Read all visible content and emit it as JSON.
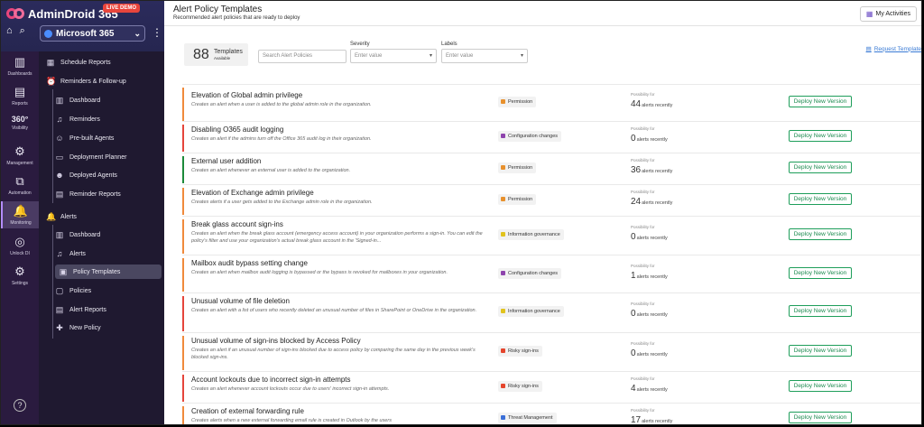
{
  "brand": {
    "name": "AdminDroid 365",
    "badge": "LIVE DEMO"
  },
  "tenant": {
    "name": "Microsoft 365"
  },
  "rail": [
    {
      "label": "Dashboards",
      "icon": "dashboards-icon"
    },
    {
      "label": "Reports",
      "icon": "reports-icon"
    },
    {
      "label": "Visibility",
      "icon": "visibility-360-icon"
    },
    {
      "label": "Management",
      "icon": "management-icon"
    },
    {
      "label": "Automation",
      "icon": "automation-icon"
    },
    {
      "label": "Monitoring",
      "icon": "monitoring-icon"
    },
    {
      "label": "Unlock DI",
      "icon": "unlock-di-icon"
    },
    {
      "label": "Settings",
      "icon": "settings-icon"
    }
  ],
  "nav": {
    "schedule_reports": "Schedule Reports",
    "reminders_followup": "Reminders & Follow-up",
    "rem_dashboard": "Dashboard",
    "reminders": "Reminders",
    "prebuilt_agents": "Pre-built Agents",
    "deployment_planner": "Deployment Planner",
    "deployed_agents": "Deployed Agents",
    "reminder_reports": "Reminder Reports",
    "alerts": "Alerts",
    "alerts_dashboard": "Dashboard",
    "alerts_alerts": "Alerts",
    "policy_templates": "Policy Templates",
    "policies": "Policies",
    "alert_reports": "Alert Reports",
    "new_policy": "New Policy"
  },
  "header": {
    "title": "Alert Policy Templates",
    "subtitle": "Recommended alert policies that are ready to deploy",
    "my_activities": "My Activities"
  },
  "toolbar": {
    "count": "88",
    "count_label": "Templates",
    "count_sub": "Available",
    "search_placeholder": "Search Alert Policies",
    "severity_label": "Severity",
    "severity_value": "Enter value",
    "labels_label": "Labels",
    "labels_value": "Enter value",
    "request": "Request Template"
  },
  "colors": {
    "orange": "#f08a3c",
    "red": "#e5453b",
    "green": "#1c8a3a",
    "permission": "#e8912d",
    "config": "#8e44ad",
    "infogov": "#e1c31d",
    "risky": "#e5452c",
    "threat": "#3a6fd8"
  },
  "rows": [
    {
      "title": "Elevation of Global admin privilege",
      "desc": "Creates an alert when a user is added to the global admin role in the organization.",
      "label": "Permission",
      "possibility": "Possibility for",
      "count": "44",
      "unit": "alerts recently",
      "deploy": "Deploy New Version"
    },
    {
      "title": "Disabling O365 audit logging",
      "desc": "Creates an alert if the admins turn off the Office 365 audit log in their organization.",
      "label": "Configuration changes",
      "possibility": "Possibility for",
      "count": "0",
      "unit": "alerts recently",
      "deploy": "Deploy New Version"
    },
    {
      "title": "External user addition",
      "desc": "Creates an alert whenever an external user is added to the organization.",
      "label": "Permission",
      "possibility": "Possibility for",
      "count": "36",
      "unit": "alerts recently",
      "deploy": "Deploy New Version"
    },
    {
      "title": "Elevation of Exchange admin privilege",
      "desc": "Creates alerts if a user gets added to the Exchange admin role in the organization.",
      "label": "Permission",
      "possibility": "Possibility for",
      "count": "24",
      "unit": "alerts recently",
      "deploy": "Deploy New Version"
    },
    {
      "title": "Break glass account sign-ins",
      "desc": "Creates an alert when the break glass account (emergency access account) in your organization performs a sign-in. You can edit the policy's filter and use your organization's actual break glass account in the 'Signed-in...",
      "label": "Information governance",
      "possibility": "Possibility for",
      "count": "0",
      "unit": "alerts recently",
      "deploy": "Deploy New Version"
    },
    {
      "title": "Mailbox audit bypass setting change",
      "desc": "Creates an alert when mailbox audit logging is bypassed or the bypass is revoked for mailboxes in your organization.",
      "label": "Configuration changes",
      "possibility": "Possibility for",
      "count": "1",
      "unit": "alerts recently",
      "deploy": "Deploy New Version"
    },
    {
      "title": "Unusual volume of file deletion",
      "desc": "Creates an alert with a list of users who recently deleted an unusual number of files in SharePoint or OneDrive in the organization.",
      "label": "Information governance",
      "possibility": "Possibility for",
      "count": "0",
      "unit": "alerts recently",
      "deploy": "Deploy New Version"
    },
    {
      "title": "Unusual volume of sign-ins blocked by Access Policy",
      "desc": "Creates an alert if an unusual number of sign-ins blocked due to access policy by comparing the same day in the previous week's blocked sign-ins.",
      "label": "Risky sign-ins",
      "possibility": "Possibility for",
      "count": "0",
      "unit": "alerts recently",
      "deploy": "Deploy New Version"
    },
    {
      "title": "Account lockouts due to incorrect sign-in attempts",
      "desc": "Creates an alert whenever account lockouts occur due to users' incorrect sign-in attempts.",
      "label": "Risky sign-ins",
      "possibility": "Possibility for",
      "count": "4",
      "unit": "alerts recently",
      "deploy": "Deploy New Version"
    },
    {
      "title": "Creation of external forwarding rule",
      "desc": "Creates alerts when a new external forwarding email rule is created in Outlook by the users",
      "label": "Threat Management",
      "possibility": "Possibility for",
      "count": "17",
      "unit": "alerts recently",
      "deploy": "Deploy New Version"
    }
  ]
}
